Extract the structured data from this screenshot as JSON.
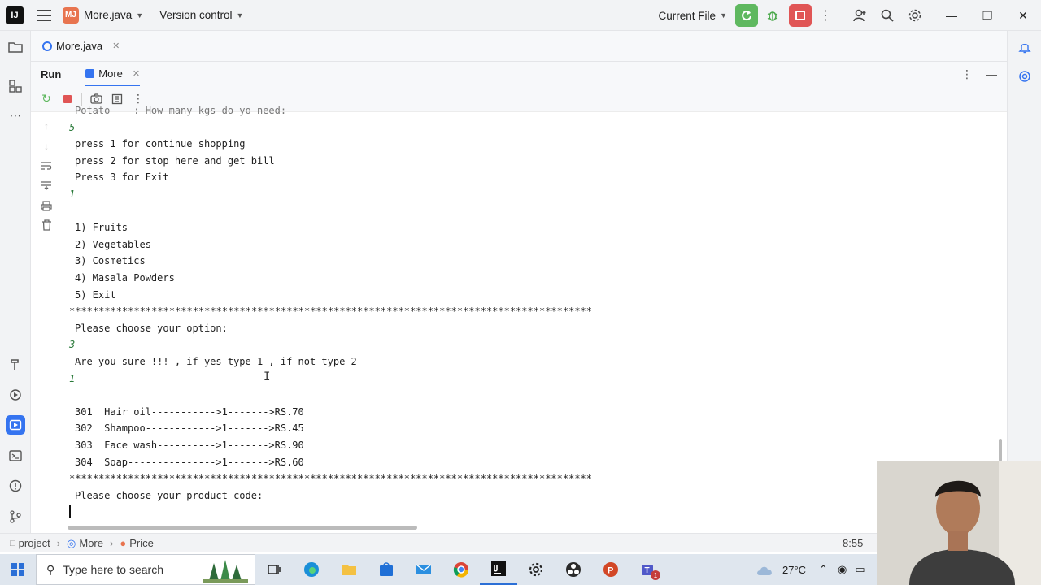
{
  "titlebar": {
    "logo_text": "IJ",
    "project_initials": "MJ",
    "file_name": "More.java",
    "version_control": "Version control",
    "run_config": "Current File"
  },
  "editor_tabs": [
    {
      "label": "More.java"
    }
  ],
  "run_panel": {
    "title": "Run",
    "tab_label": "More"
  },
  "console": {
    "top_partial": "Potato  - : How many kgs do yo need:",
    "lines": [
      {
        "text": "5",
        "kind": "in"
      },
      {
        "text": "press 1 for continue shopping",
        "kind": "out"
      },
      {
        "text": "press 2 for stop here and get bill",
        "kind": "out"
      },
      {
        "text": "Press 3 for Exit",
        "kind": "out"
      },
      {
        "text": "1",
        "kind": "in"
      },
      {
        "text": "",
        "kind": "out"
      },
      {
        "text": "1) Fruits",
        "kind": "out"
      },
      {
        "text": "2) Vegetables",
        "kind": "out"
      },
      {
        "text": "3) Cosmetics",
        "kind": "out"
      },
      {
        "text": "4) Masala Powders",
        "kind": "out"
      },
      {
        "text": "5) Exit",
        "kind": "out"
      },
      {
        "text": "*****************************************************************************************",
        "kind": "sep"
      },
      {
        "text": "Please choose your option:",
        "kind": "out"
      },
      {
        "text": "3",
        "kind": "in"
      },
      {
        "text": "Are you sure !!! , if yes type 1 , if not type 2",
        "kind": "out"
      },
      {
        "text": "1",
        "kind": "in"
      },
      {
        "text": "",
        "kind": "out"
      },
      {
        "text": "301  Hair oil----------->1------->RS.70",
        "kind": "out"
      },
      {
        "text": "302  Shampoo------------>1------->RS.45",
        "kind": "out"
      },
      {
        "text": "303  Face wash---------->1------->RS.90",
        "kind": "out"
      },
      {
        "text": "304  Soap--------------->1------->RS.60",
        "kind": "out"
      },
      {
        "text": "*****************************************************************************************",
        "kind": "sep"
      },
      {
        "text": "Please choose your product code:",
        "kind": "out"
      }
    ]
  },
  "statusbar": {
    "crumbs": [
      "project",
      "More",
      "Price"
    ],
    "position": "8:55"
  },
  "taskbar": {
    "search_placeholder": "Type here to search",
    "temperature": "27°C",
    "notification_count": "1"
  }
}
